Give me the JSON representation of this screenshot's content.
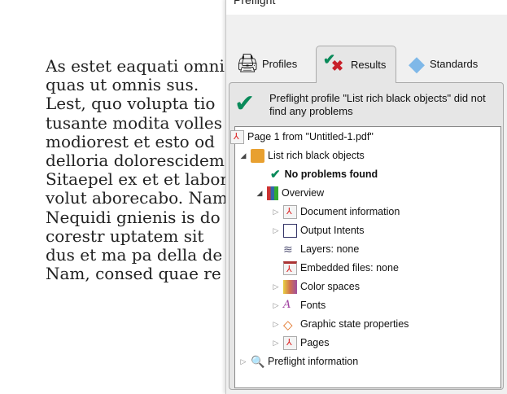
{
  "document": {
    "lines": [
      "As estet eaquati omnis",
      "quas ut omnis sus.",
      "Lest, quo volupta tio",
      "tusante modita volles",
      "modiorest et esto od",
      "delloria dolorescidem",
      "Sitaepel ex et et labore",
      "volut aborecabo. Nam",
      "Nequidi gnienis is do",
      "corestr uptatem sit",
      "dus et ma pa della de",
      "Nam, consed quae re"
    ]
  },
  "dialog": {
    "title": "Preflight",
    "tabs": [
      {
        "label": "Profiles"
      },
      {
        "label": "Results"
      },
      {
        "label": "Standards"
      }
    ],
    "message": "Preflight profile \"List rich black objects\" did not find any problems",
    "tree": {
      "root": "Page 1 from \"Untitled-1.pdf\"",
      "profile": "List rich black objects",
      "no_problems": "No problems found",
      "overview": "Overview",
      "items": [
        "Document information",
        "Output Intents",
        "Layers: none",
        "Embedded files: none",
        "Color spaces",
        "Fonts",
        "Graphic state properties",
        "Pages"
      ],
      "info": "Preflight information"
    }
  },
  "colors": {
    "check": "#0a8a5a",
    "cross": "#c8202a"
  }
}
